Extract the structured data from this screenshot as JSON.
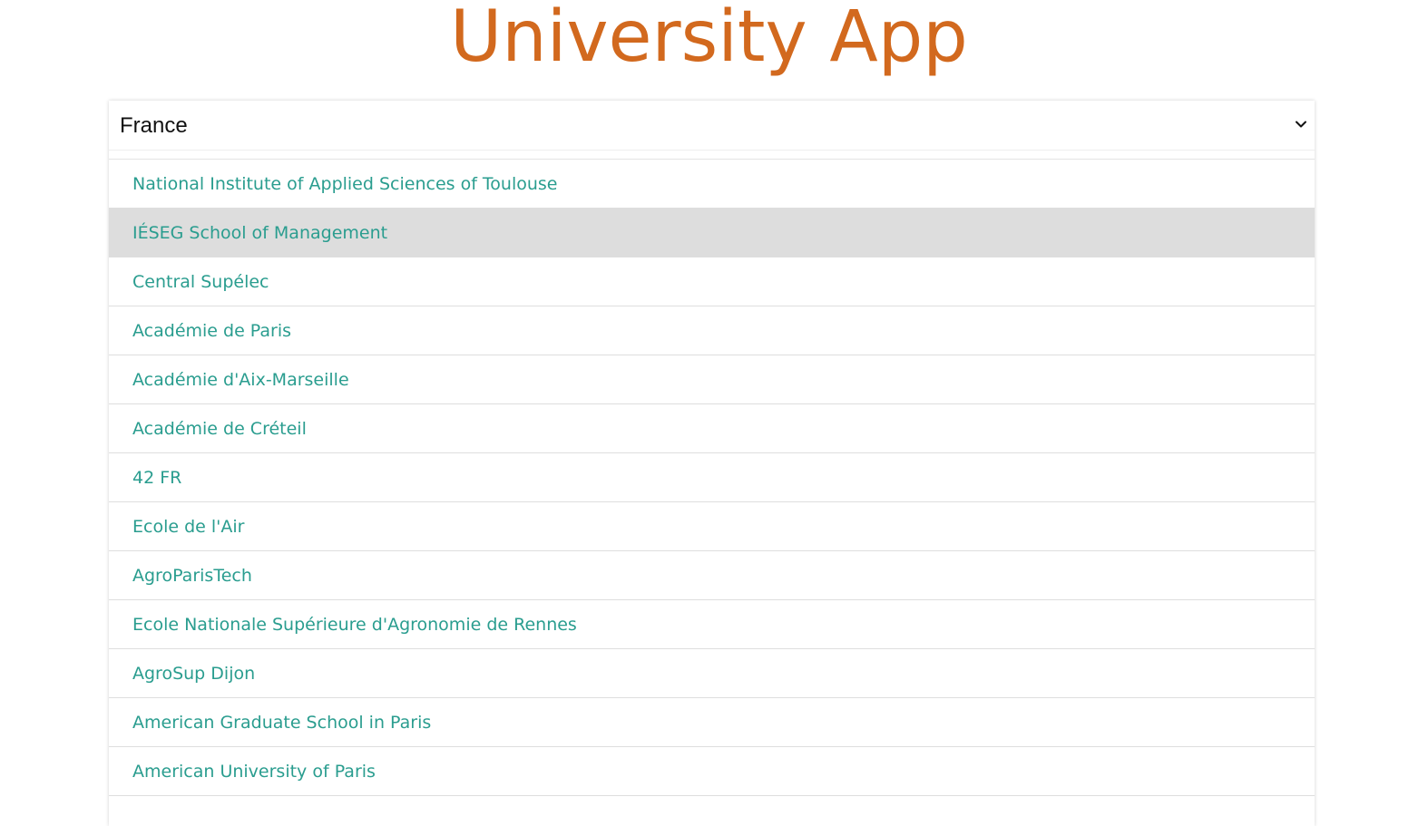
{
  "app": {
    "title": "University App",
    "accent_color": "#d2691e",
    "link_color": "#2a9d8f"
  },
  "country_select": {
    "selected": "France",
    "icon": "chevron-down-icon"
  },
  "universities": [
    {
      "name": "National Institute of Applied Sciences of Toulouse"
    },
    {
      "name": "IÉSEG School of Management",
      "highlighted": true
    },
    {
      "name": "Central Supélec"
    },
    {
      "name": "Académie de Paris"
    },
    {
      "name": "Académie d'Aix-Marseille"
    },
    {
      "name": "Académie de Créteil"
    },
    {
      "name": "42 FR"
    },
    {
      "name": "Ecole de l'Air"
    },
    {
      "name": "AgroParisTech"
    },
    {
      "name": "Ecole Nationale Supérieure d'Agronomie de Rennes"
    },
    {
      "name": "AgroSup Dijon"
    },
    {
      "name": "American Graduate School in Paris"
    },
    {
      "name": "American University of Paris"
    }
  ]
}
